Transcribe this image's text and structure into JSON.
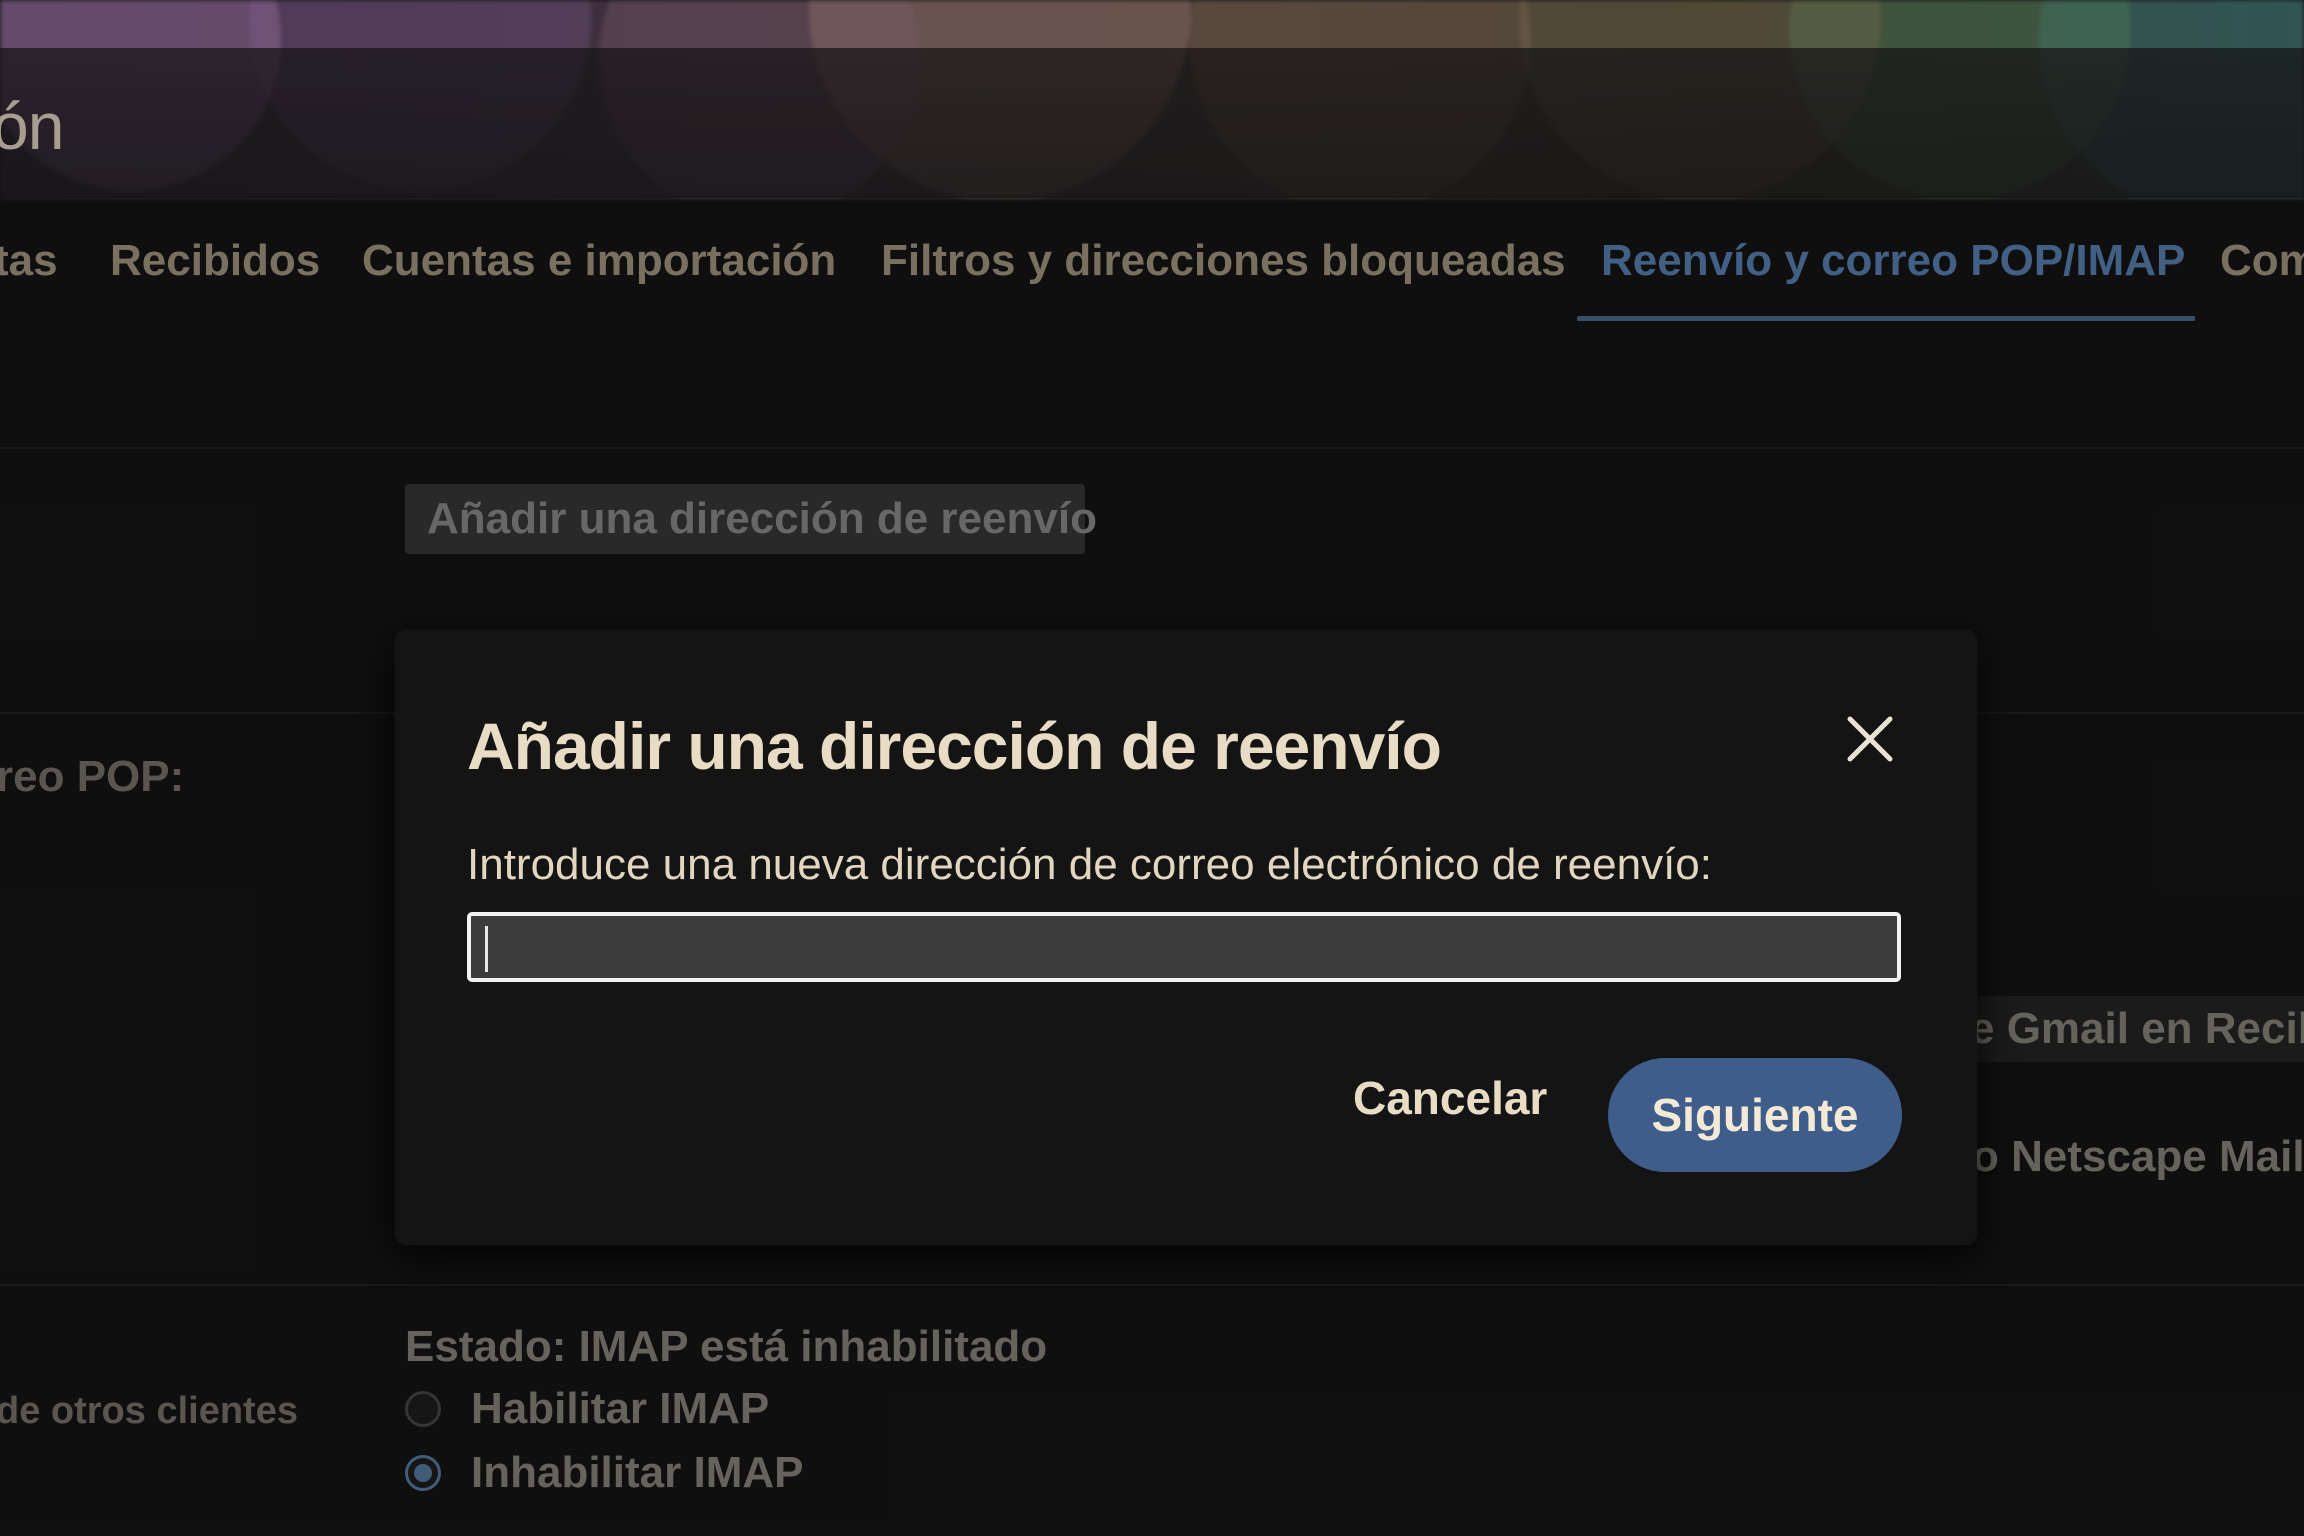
{
  "header": {
    "page_title": "ón"
  },
  "tabs": [
    {
      "label": "tas"
    },
    {
      "label": "Recibidos"
    },
    {
      "label": "Cuentas e importación"
    },
    {
      "label": "Filtros y direcciones bloqueadas"
    },
    {
      "label": "Reenvío y correo POP/IMAP",
      "active": true
    },
    {
      "label": "Com"
    }
  ],
  "forwarding": {
    "add_button_label": "Añadir una dirección de reenvío"
  },
  "pop": {
    "section_label": "reo POP:",
    "option_gmail_inbox_text": "e Gmail en Recibi",
    "option_netscape_text": "o Netscape Mail)"
  },
  "imap": {
    "section_label": "de otros clientes",
    "status": "Estado: IMAP está inhabilitado",
    "options": [
      {
        "label": "Habilitar IMAP",
        "checked": false
      },
      {
        "label": "Inhabilitar IMAP",
        "checked": true
      }
    ]
  },
  "dialog": {
    "title": "Añadir una dirección de reenvío",
    "prompt": "Introduce una nueva dirección de correo electrónico de reenvío:",
    "input_value": "",
    "cancel_label": "Cancelar",
    "next_label": "Siguiente"
  },
  "colors": {
    "accent": "#3e5d8a",
    "active_tab": "#5b86b8",
    "dialog_text": "#e9dcc5"
  }
}
